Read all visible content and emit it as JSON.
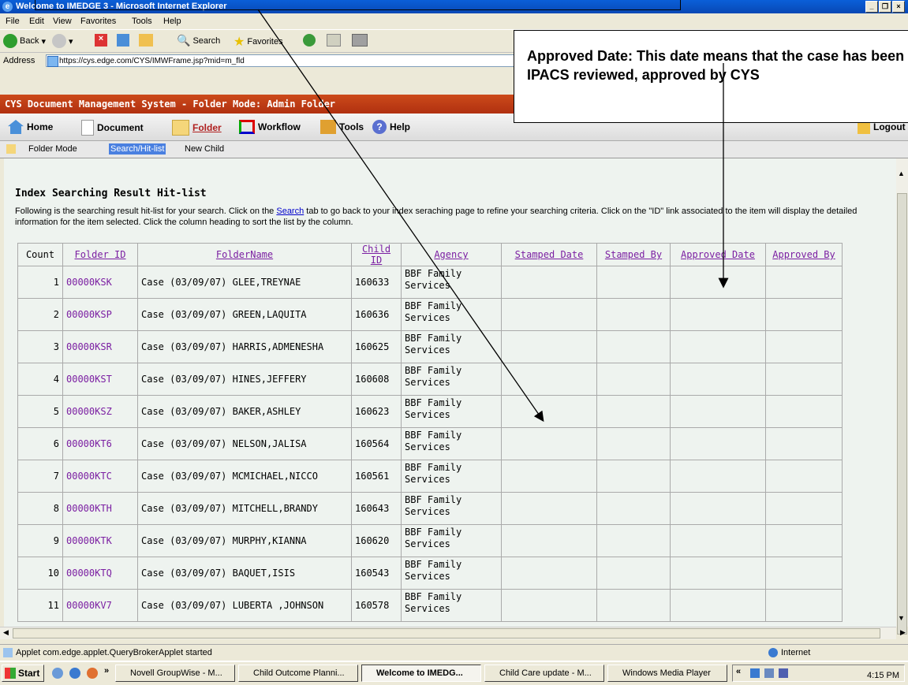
{
  "window": {
    "title": "Welcome to IMEDGE 3 - Microsoft Internet Explorer"
  },
  "menu": [
    "File",
    "Edit",
    "View",
    "Favorites",
    "Tools",
    "Help"
  ],
  "toolbar": {
    "back": "Back",
    "search": "Search",
    "favorites": "Favorites"
  },
  "address": {
    "label": "Address",
    "url": "https://cys.edge.com/CYS/IMWFrame.jsp?mid=m_fld"
  },
  "app": {
    "header": "CYS Document Management System - Folder Mode: Admin Folder",
    "nav": [
      "Home",
      "Document",
      "Folder",
      "Workflow",
      "Tools",
      "Help"
    ],
    "logout": "Logout",
    "subtabs": [
      "Folder Mode",
      "Search/Hit-list",
      "New Child"
    ]
  },
  "content": {
    "heading": "Index Searching Result Hit-list",
    "desc_before": "Following is the searching result hit-list for your search.  Click on the ",
    "desc_link": "Search",
    "desc_after": " tab to go back to your index seraching page to refine your searching criteria.  Click on the \"ID\" link associated to the item will display the detailed information for the item selected.  Click the column heading to sort the list by the column.",
    "columns": [
      "Count",
      "Folder ID",
      "FolderName",
      "Child ID",
      "Agency",
      "Stamped Date",
      "Stamped By",
      "Approved Date",
      "Approved By"
    ],
    "rows": [
      {
        "count": "1",
        "fid": "00000KSK",
        "name": "Case (03/09/07) GLEE,TREYNAE",
        "child": "160633",
        "agency": "BBF Family Services"
      },
      {
        "count": "2",
        "fid": "00000KSP",
        "name": "Case (03/09/07) GREEN,LAQUITA",
        "child": "160636",
        "agency": "BBF Family Services"
      },
      {
        "count": "3",
        "fid": "00000KSR",
        "name": "Case (03/09/07) HARRIS,ADMENESHA",
        "child": "160625",
        "agency": "BBF Family Services"
      },
      {
        "count": "4",
        "fid": "00000KST",
        "name": "Case (03/09/07) HINES,JEFFERY",
        "child": "160608",
        "agency": "BBF Family Services"
      },
      {
        "count": "5",
        "fid": "00000KSZ",
        "name": "Case (03/09/07) BAKER,ASHLEY",
        "child": "160623",
        "agency": "BBF Family Services"
      },
      {
        "count": "6",
        "fid": "00000KT6",
        "name": "Case (03/09/07) NELSON,JALISA",
        "child": "160564",
        "agency": "BBF Family Services"
      },
      {
        "count": "7",
        "fid": "00000KTC",
        "name": "Case (03/09/07) MCMICHAEL,NICCO",
        "child": "160561",
        "agency": "BBF Family Services"
      },
      {
        "count": "8",
        "fid": "00000KTH",
        "name": "Case (03/09/07) MITCHELL,BRANDY",
        "child": "160643",
        "agency": "BBF Family Services"
      },
      {
        "count": "9",
        "fid": "00000KTK",
        "name": "Case (03/09/07) MURPHY,KIANNA",
        "child": "160620",
        "agency": "BBF Family Services"
      },
      {
        "count": "10",
        "fid": "00000KTQ",
        "name": "Case (03/09/07) BAQUET,ISIS",
        "child": "160543",
        "agency": "BBF Family Services"
      },
      {
        "count": "11",
        "fid": "00000KV7",
        "name": "Case (03/09/07) LUBERTA ,JOHNSON",
        "child": "160578",
        "agency": "BBF Family Services"
      }
    ]
  },
  "status": {
    "message": "Applet com.edge.applet.QueryBrokerApplet started",
    "zone": "Internet"
  },
  "taskbar": {
    "start": "Start",
    "tasks": [
      "Novell GroupWise - M...",
      "Child Outcome Planni...",
      "Welcome to IMEDG...",
      "Child Care update - M...",
      "Windows Media Player"
    ],
    "clock": "4:15 PM"
  },
  "callout": {
    "text": "Approved Date: This date means that the case has been IPACS reviewed, approved by CYS"
  }
}
